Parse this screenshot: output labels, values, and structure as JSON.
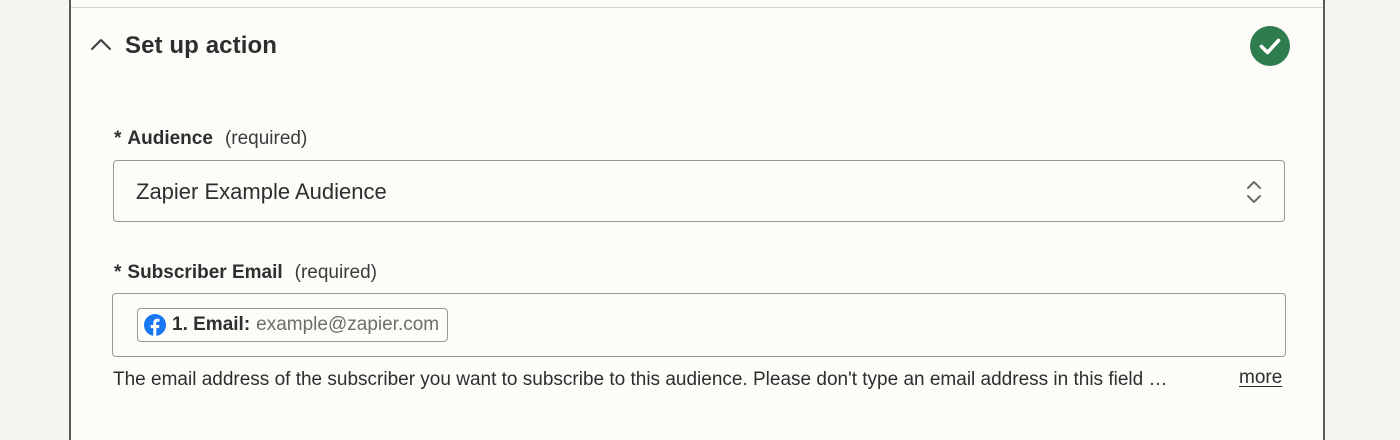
{
  "section": {
    "title": "Set up action",
    "status": "complete",
    "status_color": "#2f7d4e"
  },
  "fields": {
    "audience": {
      "required_marker": "*",
      "label": "Audience",
      "required_text": "(required)",
      "value": "Zapier Example Audience"
    },
    "subscriber_email": {
      "required_marker": "*",
      "label": "Subscriber Email",
      "required_text": "(required)",
      "pill": {
        "icon": "facebook-icon",
        "label": "1. Email:",
        "value": "example@zapier.com"
      },
      "help_text": "The email address of the subscriber you want to subscribe to this audience. Please don't type an email address in this field — map it from a previous step.",
      "more_label": "more"
    }
  },
  "colors": {
    "accent_success": "#2f7d4e",
    "facebook_blue": "#1877f2",
    "panel_bg": "#fdfcf9",
    "page_bg": "#f7f5f0"
  }
}
